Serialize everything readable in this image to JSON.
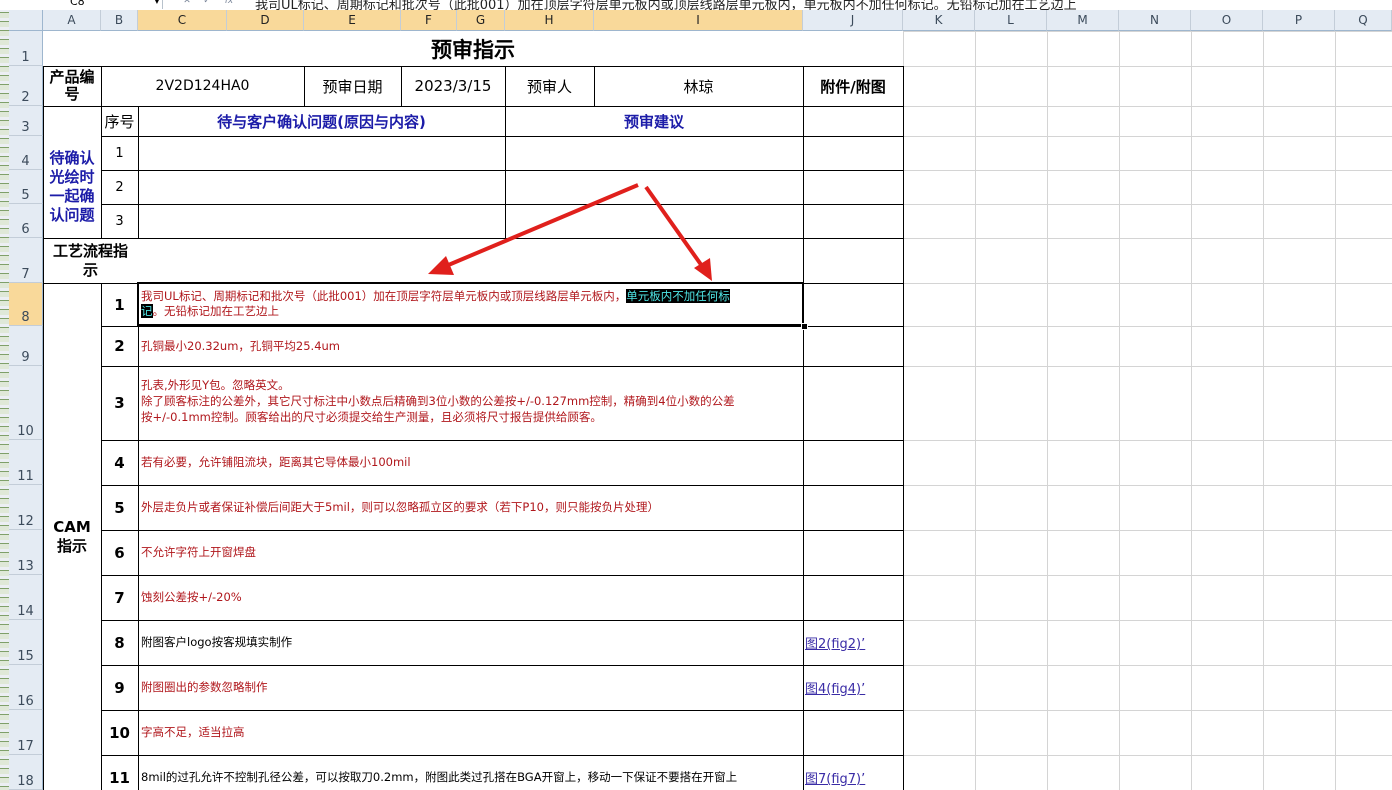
{
  "formula_bar": {
    "name_box": "C8",
    "formula_text": "我司UL标记、周期标记和批次号（此批001）加在顶层字符层单元板内或顶层线路层单元板内，单元板内不加任何标记。无铅标记加在工艺边上"
  },
  "columns": [
    "A",
    "B",
    "C",
    "D",
    "E",
    "F",
    "G",
    "H",
    "I",
    "J",
    "K",
    "L",
    "M",
    "N",
    "O",
    "P",
    "Q"
  ],
  "rows": [
    "1",
    "2",
    "3",
    "4",
    "5",
    "6",
    "7",
    "8",
    "9",
    "10",
    "11",
    "12",
    "13",
    "14",
    "15",
    "16",
    "17",
    "18"
  ],
  "sheet": {
    "title": "预审指示",
    "header": {
      "product_code_label": "产品编号",
      "product_code": "2V2D124HA0",
      "review_date_label": "预审日期",
      "review_date": "2023/3/15",
      "reviewer_label": "预审人",
      "reviewer": "林琼",
      "attachment_label": "附件/附图"
    },
    "confirm_section": {
      "label": "待确认光绘时一起确认问题",
      "seq_label": "序号",
      "issue_label": "待与客户确认问题(原因与内容)",
      "suggest_label": "预审建议",
      "items": [
        "1",
        "2",
        "3"
      ]
    },
    "process_label": "工艺流程指示",
    "cam_label": "CAM指示",
    "cam_items": [
      {
        "no": "1",
        "text_before": "我司UL标记、周期标记和批次号（此批001）加在顶层字符层单元板内或顶层线路层单元板内，",
        "text_highlight": "单元板内不加任何标",
        "text_highlight2": "记",
        "text_after": "。无铅标记加在工艺边上",
        "attachment": ""
      },
      {
        "no": "2",
        "text": "孔铜最小20.32um，孔铜平均25.4um",
        "attachment": ""
      },
      {
        "no": "3",
        "line1": "孔表,外形见Y包。忽略英文。",
        "line2": "除了顾客标注的公差外，其它尺寸标注中小数点后精确到3位小数的公差按+/-0.127mm控制，精确到4位小数的公差",
        "line3": "按+/-0.1mm控制。顾客给出的尺寸必须提交给生产测量，且必须将尺寸报告提供给顾客。",
        "attachment": ""
      },
      {
        "no": "4",
        "text": "若有必要，允许铺阻流块，距离其它导体最小100mil",
        "attachment": ""
      },
      {
        "no": "5",
        "text": "外层走负片或者保证补偿后间距大于5mil，则可以忽略孤立区的要求（若下P10，则只能按负片处理）",
        "attachment": ""
      },
      {
        "no": "6",
        "text": "不允许字符上开窗焊盘",
        "attachment": ""
      },
      {
        "no": "7",
        "text": "蚀刻公差按+/-20%",
        "attachment": ""
      },
      {
        "no": "8",
        "text": "附图客户logo按客规填实制作",
        "attachment": "图2(fig2)’"
      },
      {
        "no": "9",
        "text": "附图圈出的参数忽略制作",
        "attachment": "图4(fig4)’"
      },
      {
        "no": "10",
        "text": "字高不足，适当拉高",
        "attachment": ""
      },
      {
        "no": "11",
        "text": "8mil的过孔允许不控制孔径公差，可以按取刀0.2mm，附图此类过孔搭在BGA开窗上，移动一下保证不要搭在开窗上",
        "attachment": "图7(fig7)’"
      }
    ]
  },
  "colors": {
    "header_bg": "#e4ebf3",
    "selected_header": "#f9d99a",
    "blue_text": "#1c1ca8",
    "red_text": "#b0171c",
    "annotation_arrow": "#e0201c",
    "highlight_text": "#4fe5e5"
  }
}
